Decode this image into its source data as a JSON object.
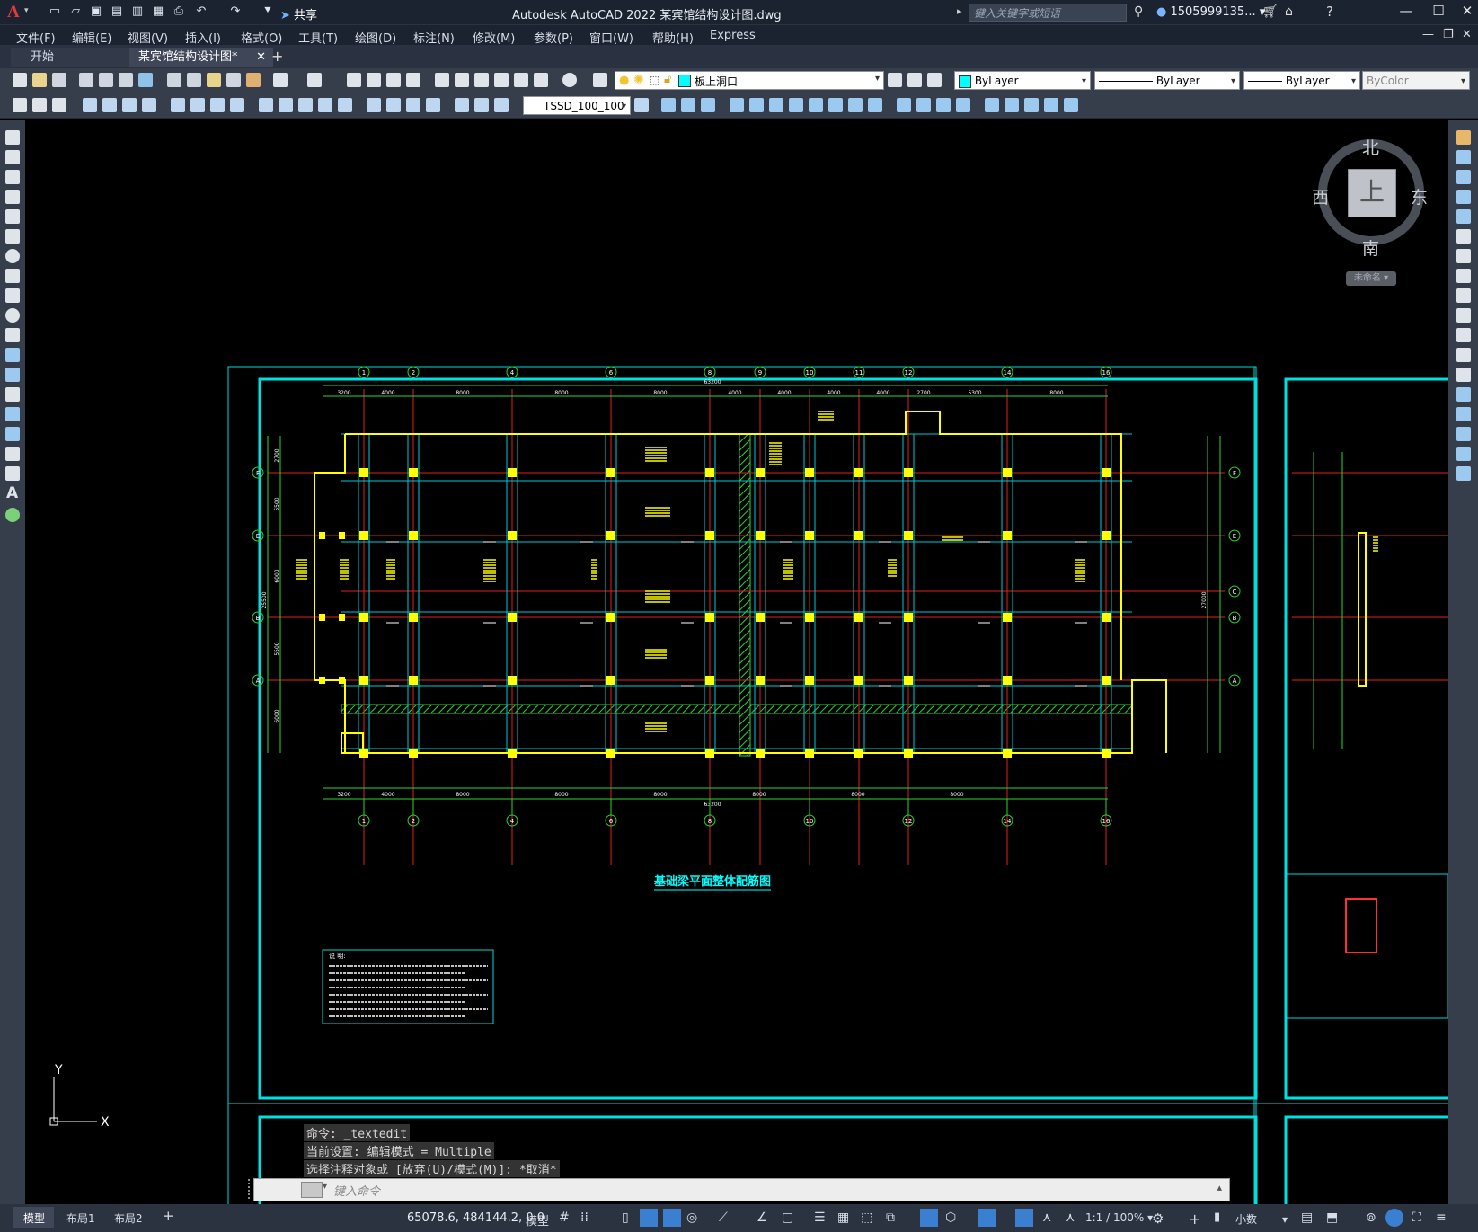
{
  "app": {
    "logo": "A",
    "title": "Autodesk AutoCAD 2022    某宾馆结构设计图.dwg",
    "share_label": "共享",
    "search_placeholder": "键入关键字或短语",
    "user": "1505999135...",
    "window_controls": [
      "—",
      "☐",
      "✕"
    ]
  },
  "menu": [
    "文件(F)",
    "编辑(E)",
    "视图(V)",
    "插入(I)",
    "格式(O)",
    "工具(T)",
    "绘图(D)",
    "标注(N)",
    "修改(M)",
    "参数(P)",
    "窗口(W)",
    "帮助(H)",
    "Express"
  ],
  "tabs": {
    "start": "开始",
    "drawing": "某宾馆结构设计图*",
    "close": "✕",
    "add": "+"
  },
  "properties": {
    "layer": "板上洞口",
    "color": "ByLayer",
    "linetype": "ByLayer",
    "lineweight": "ByLayer",
    "plotstyle": "ByColor",
    "textstyle": "TSSD_100_100"
  },
  "viewcube": {
    "north": "北",
    "south": "南",
    "east": "东",
    "west": "西",
    "top": "上",
    "ucs": "未命名"
  },
  "ucs_icon": {
    "y": "Y",
    "x": "X"
  },
  "drawing": {
    "title": "基础梁平面整体配筋图",
    "total_dim": "63200",
    "axes_top": [
      "1",
      "2",
      "4",
      "6",
      "8",
      "9",
      "10",
      "11",
      "12",
      "14",
      "16"
    ],
    "axes_bottom": [
      "1",
      "2",
      "4",
      "6",
      "8",
      "10",
      "12",
      "14",
      "16"
    ],
    "dims_top": [
      "3200",
      "4000",
      "8000",
      "8000",
      "8000",
      "4000",
      "4000",
      "4000",
      "4000",
      "2700",
      "5300",
      "8000"
    ],
    "dims_bottom": [
      "3200",
      "4000",
      "8000",
      "8000",
      "8000",
      "8000",
      "8000",
      "8000"
    ],
    "rows_left": [
      "F",
      "E",
      "B",
      "A"
    ],
    "rows_right": [
      "F",
      "E",
      "C",
      "B",
      "A"
    ],
    "dims_left": [
      "2700",
      "5500",
      "6000",
      "5500",
      "6000"
    ],
    "overall_left": "25500",
    "overall_right": "27000",
    "notes_heading": "说 明:"
  },
  "command": {
    "history": [
      "命令: _textedit",
      "当前设置: 编辑模式 = Multiple",
      "选择注释对象或 [放弃(U)/模式(M)]: *取消*"
    ],
    "placeholder": "键入命令"
  },
  "status": {
    "layouts": [
      "模型",
      "布局1",
      "布局2"
    ],
    "add": "+",
    "coords": "65078.6, 484144.2, 0.0",
    "space": "模型",
    "scale": "1:1 / 100%",
    "units": "小数"
  }
}
